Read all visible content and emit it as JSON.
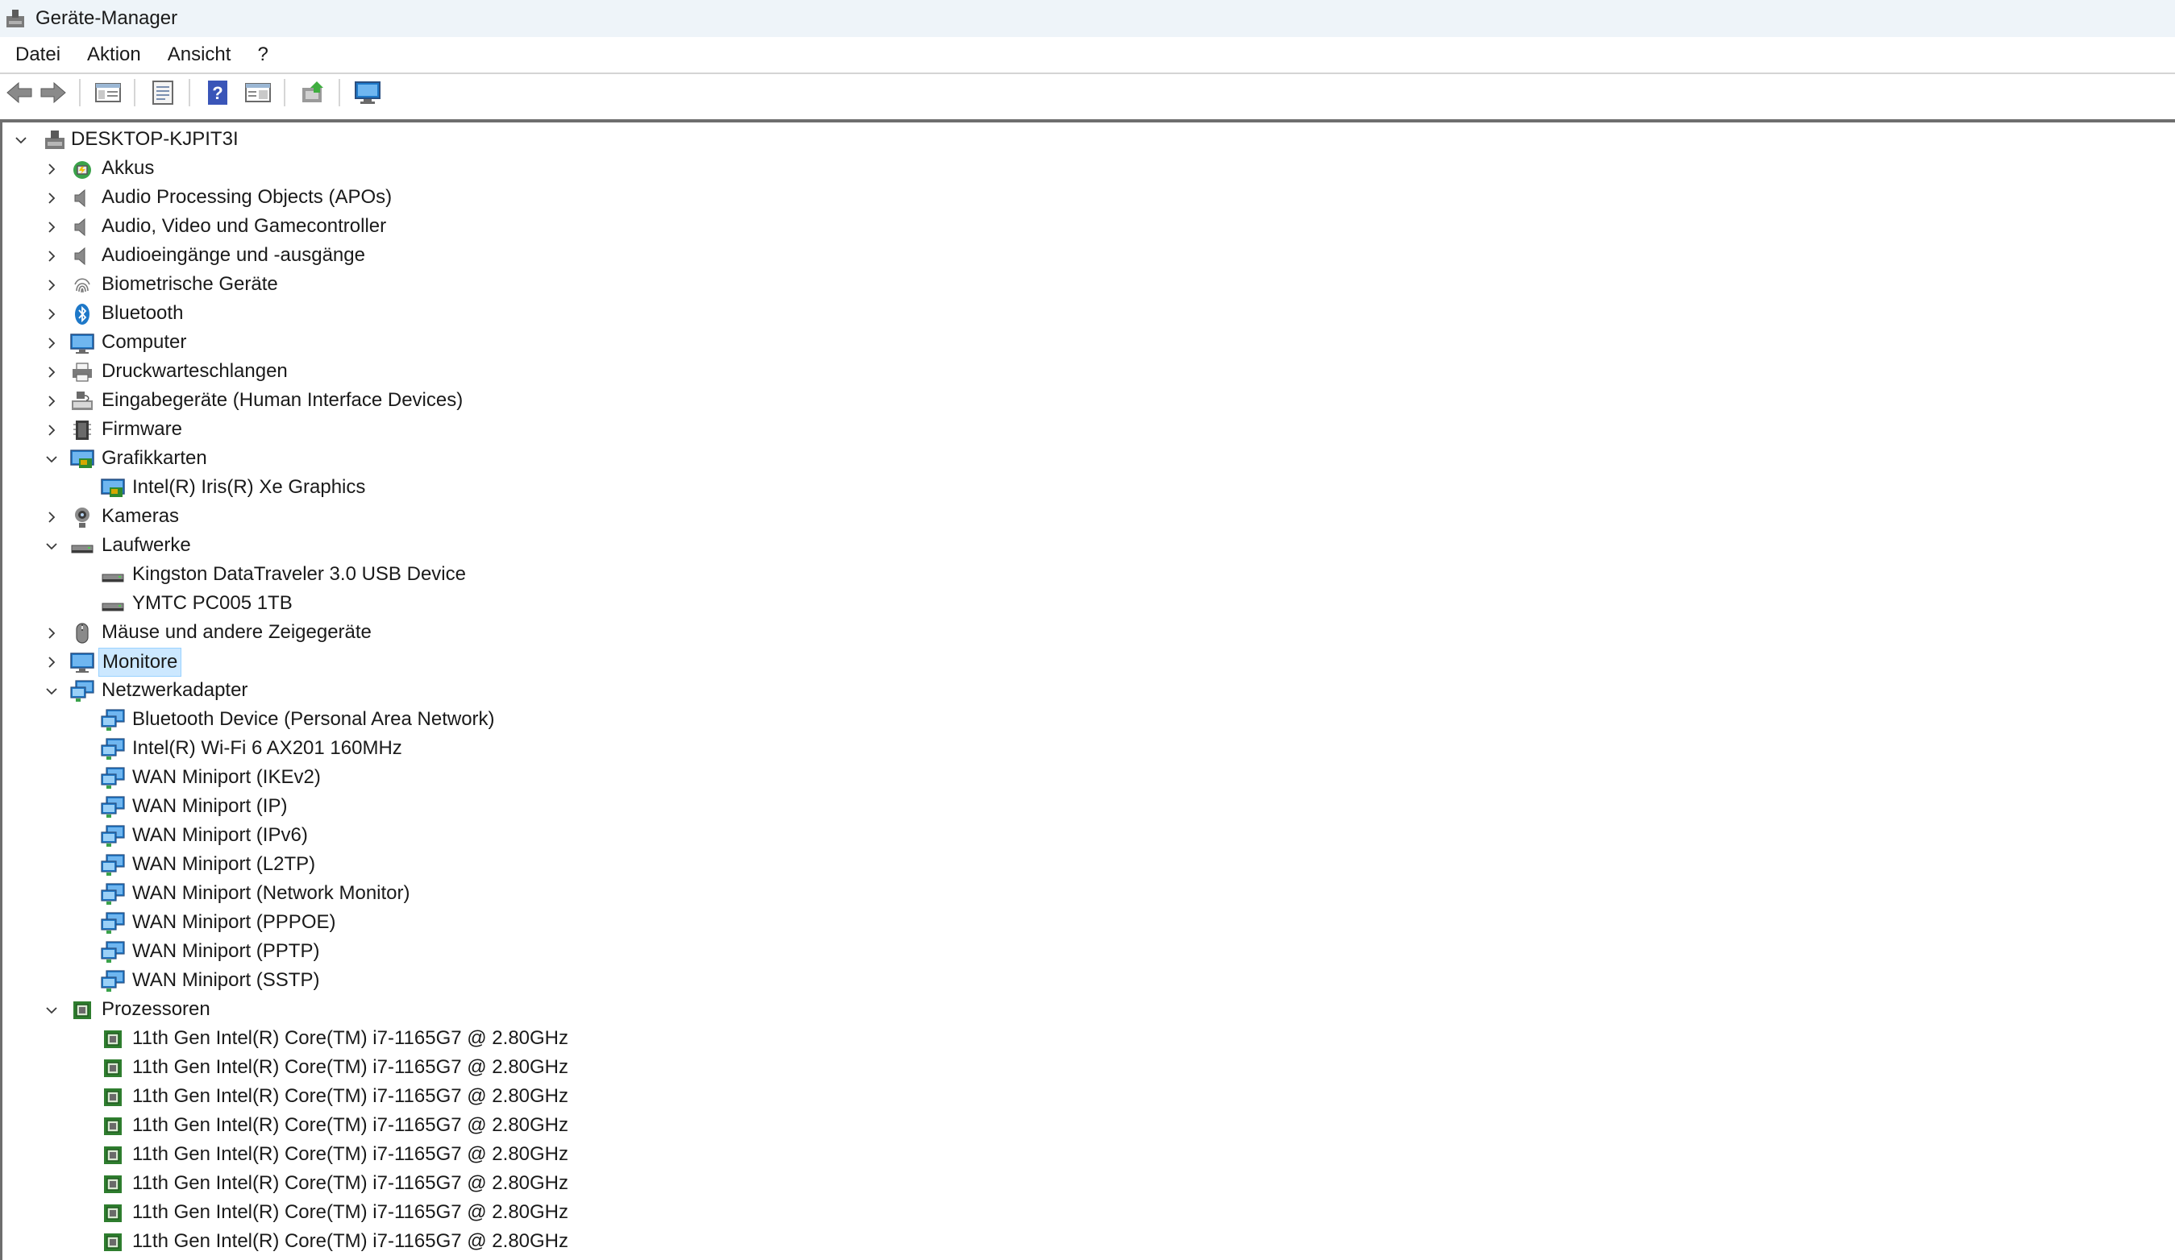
{
  "window": {
    "title": "Geräte-Manager"
  },
  "menu": [
    "Datei",
    "Aktion",
    "Ansicht",
    "?"
  ],
  "toolbar": [
    "back-icon",
    "forward-icon",
    "show-hide-tree-icon",
    "properties-icon",
    "help-icon",
    "view-icon",
    "update-driver-icon",
    "scan-hardware-icon"
  ],
  "tree": {
    "root": "DESKTOP-KJPIT3I",
    "categories": [
      {
        "label": "Akkus",
        "icon": "battery-icon",
        "expanded": false,
        "children": []
      },
      {
        "label": "Audio Processing Objects (APOs)",
        "icon": "speaker-icon",
        "expanded": false,
        "children": []
      },
      {
        "label": "Audio, Video und Gamecontroller",
        "icon": "speaker-icon",
        "expanded": false,
        "children": []
      },
      {
        "label": "Audioeingänge und -ausgänge",
        "icon": "speaker-icon",
        "expanded": false,
        "children": []
      },
      {
        "label": "Biometrische Geräte",
        "icon": "fingerprint-icon",
        "expanded": false,
        "children": []
      },
      {
        "label": "Bluetooth",
        "icon": "bluetooth-icon",
        "expanded": false,
        "children": []
      },
      {
        "label": "Computer",
        "icon": "monitor-icon",
        "expanded": false,
        "children": []
      },
      {
        "label": "Druckwarteschlangen",
        "icon": "printer-icon",
        "expanded": false,
        "children": []
      },
      {
        "label": "Eingabegeräte (Human Interface Devices)",
        "icon": "hid-icon",
        "expanded": false,
        "children": []
      },
      {
        "label": "Firmware",
        "icon": "firmware-icon",
        "expanded": false,
        "children": []
      },
      {
        "label": "Grafikkarten",
        "icon": "display-adapter-icon",
        "expanded": true,
        "children": [
          {
            "label": "Intel(R) Iris(R) Xe Graphics",
            "icon": "display-adapter-icon"
          }
        ]
      },
      {
        "label": "Kameras",
        "icon": "camera-icon",
        "expanded": false,
        "children": []
      },
      {
        "label": "Laufwerke",
        "icon": "drive-icon",
        "expanded": true,
        "children": [
          {
            "label": "Kingston DataTraveler 3.0 USB Device",
            "icon": "drive-icon"
          },
          {
            "label": "YMTC PC005 1TB",
            "icon": "drive-icon"
          }
        ]
      },
      {
        "label": "Mäuse und andere Zeigegeräte",
        "icon": "mouse-icon",
        "expanded": false,
        "children": []
      },
      {
        "label": "Monitore",
        "icon": "monitor-icon",
        "expanded": false,
        "selected": true,
        "children": []
      },
      {
        "label": "Netzwerkadapter",
        "icon": "network-icon",
        "expanded": true,
        "children": [
          {
            "label": "Bluetooth Device (Personal Area Network)",
            "icon": "network-icon"
          },
          {
            "label": "Intel(R) Wi-Fi 6 AX201 160MHz",
            "icon": "network-icon"
          },
          {
            "label": "WAN Miniport (IKEv2)",
            "icon": "network-icon"
          },
          {
            "label": "WAN Miniport (IP)",
            "icon": "network-icon"
          },
          {
            "label": "WAN Miniport (IPv6)",
            "icon": "network-icon"
          },
          {
            "label": "WAN Miniport (L2TP)",
            "icon": "network-icon"
          },
          {
            "label": "WAN Miniport (Network Monitor)",
            "icon": "network-icon"
          },
          {
            "label": "WAN Miniport (PPPOE)",
            "icon": "network-icon"
          },
          {
            "label": "WAN Miniport (PPTP)",
            "icon": "network-icon"
          },
          {
            "label": "WAN Miniport (SSTP)",
            "icon": "network-icon"
          }
        ]
      },
      {
        "label": "Prozessoren",
        "icon": "processor-icon",
        "expanded": true,
        "children": [
          {
            "label": "11th Gen Intel(R) Core(TM) i7-1165G7 @ 2.80GHz",
            "icon": "processor-icon"
          },
          {
            "label": "11th Gen Intel(R) Core(TM) i7-1165G7 @ 2.80GHz",
            "icon": "processor-icon"
          },
          {
            "label": "11th Gen Intel(R) Core(TM) i7-1165G7 @ 2.80GHz",
            "icon": "processor-icon"
          },
          {
            "label": "11th Gen Intel(R) Core(TM) i7-1165G7 @ 2.80GHz",
            "icon": "processor-icon"
          },
          {
            "label": "11th Gen Intel(R) Core(TM) i7-1165G7 @ 2.80GHz",
            "icon": "processor-icon"
          },
          {
            "label": "11th Gen Intel(R) Core(TM) i7-1165G7 @ 2.80GHz",
            "icon": "processor-icon"
          },
          {
            "label": "11th Gen Intel(R) Core(TM) i7-1165G7 @ 2.80GHz",
            "icon": "processor-icon"
          },
          {
            "label": "11th Gen Intel(R) Core(TM) i7-1165G7 @ 2.80GHz",
            "icon": "processor-icon"
          }
        ]
      }
    ]
  },
  "colors": {
    "selection": "#cce8ff",
    "titlebar": "#eef4f9",
    "accent": "#1e78c8"
  }
}
